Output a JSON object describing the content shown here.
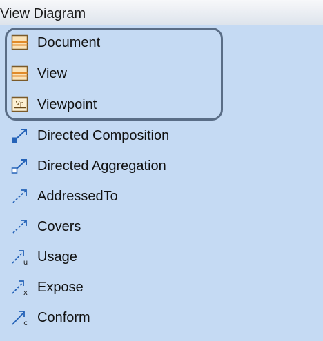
{
  "header": {
    "title": "View Diagram"
  },
  "items": [
    {
      "label": "Document",
      "icon": "document-icon"
    },
    {
      "label": "View",
      "icon": "view-icon"
    },
    {
      "label": "Viewpoint",
      "icon": "viewpoint-icon",
      "icon_text": "Vp"
    },
    {
      "label": "Directed Composition",
      "icon": "directed-composition-icon"
    },
    {
      "label": "Directed Aggregation",
      "icon": "directed-aggregation-icon"
    },
    {
      "label": "AddressedTo",
      "icon": "dependency-icon"
    },
    {
      "label": "Covers",
      "icon": "dependency-icon"
    },
    {
      "label": "Usage",
      "icon": "usage-icon",
      "icon_text": "u"
    },
    {
      "label": "Expose",
      "icon": "expose-icon",
      "icon_text": "x"
    },
    {
      "label": "Conform",
      "icon": "conform-icon",
      "icon_text": "c"
    }
  ],
  "colors": {
    "palette_background": "#c5daf3",
    "group_border": "#5a6d86",
    "icon_blue": "#2563b8",
    "icon_orange": "#e08a2a"
  }
}
